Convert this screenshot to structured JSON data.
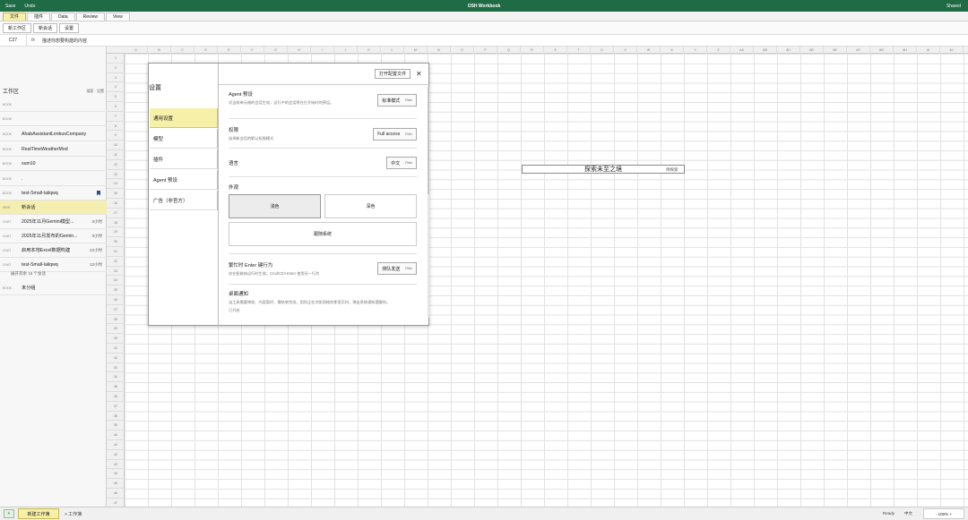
{
  "window": {
    "title": "OSH Workbook",
    "save": "Save",
    "undo": "Undo",
    "shared": "Shared"
  },
  "menu": {
    "tabs": [
      "文件",
      "插件",
      "Data",
      "Review",
      "View"
    ],
    "active_index": 0
  },
  "toolbar": {
    "buttons": [
      "新工作区",
      "新会话",
      "设置"
    ]
  },
  "formula": {
    "cell": "C27",
    "fx": "fx",
    "value": "描述你想要构建的内容"
  },
  "sidebar": {
    "header": "工作区",
    "header_actions": "搜索 · 设置",
    "items": [
      {
        "tag": "BOOK",
        "name": "",
        "time": ""
      },
      {
        "tag": "BOOK",
        "name": "",
        "time": ""
      },
      {
        "tag": "BOOK",
        "name": "AhabAssistantLimbusCompany",
        "time": ""
      },
      {
        "tag": "BOOK",
        "name": "RealTimeWeatherMod",
        "time": ""
      },
      {
        "tag": "BOOK",
        "name": "sum10",
        "time": ""
      },
      {
        "tag": "BOOK",
        "name": ".",
        "time": ""
      },
      {
        "tag": "BOOK",
        "name": "test-Small-laliqwq",
        "time": ""
      },
      {
        "tag": "NEW",
        "name": "新会话",
        "time": ""
      },
      {
        "tag": "CHAT",
        "name": "2025年11月Gemini模型...",
        "time": "3小时"
      },
      {
        "tag": "CHAT",
        "name": "2025年11月发布的Gemin...",
        "time": "3小时"
      },
      {
        "tag": "CHAT",
        "name": "启用本地Excel数据构建",
        "time": "12小时"
      },
      {
        "tag": "CHAT",
        "name": "test-Small-laliqwq",
        "time": "12小时"
      }
    ],
    "more": "展开其余 16 个会话",
    "ungrouped_tag": "BOOK",
    "ungrouped": "未分组"
  },
  "grid": {
    "columns": [
      "A",
      "B",
      "C",
      "D",
      "E",
      "F",
      "G",
      "H",
      "I",
      "J",
      "K",
      "L",
      "M",
      "N",
      "O",
      "P",
      "Q",
      "R",
      "S",
      "T",
      "U",
      "V",
      "W",
      "X",
      "Y",
      "Z",
      "AA",
      "AB",
      "AC",
      "AD",
      "AE",
      "AF",
      "AG",
      "AH",
      "AI",
      "AJ",
      "AK"
    ],
    "rows": 47,
    "cell_text": "探索未至之境",
    "cell_tag": "待探索"
  },
  "settings": {
    "title": "设置",
    "nav": [
      "通用设置",
      "模型",
      "插件",
      "Agent 预设",
      "广告（非官方）"
    ],
    "active_nav": 0,
    "open_file": "打开配置文件",
    "close": "✕",
    "agent": {
      "title": "Agent 预设",
      "desc": "对当前单元格的会话生效，运行中的会话将在它开始时的预设。",
      "value": "标准模式",
      "filter": "Filter"
    },
    "permission": {
      "title": "权限",
      "desc": "选择新会话的默认权限模式",
      "value": "Full access",
      "filter": "Filter"
    },
    "language": {
      "title": "语言",
      "value": "中文",
      "filter": "Filter"
    },
    "appearance": {
      "title": "外观",
      "light": "浅色",
      "dark": "深色",
      "system": "跟随系统"
    },
    "enter": {
      "title": "繁忙时 Enter 键行为",
      "desc": "仅在智能体运行时生效，Cmd/Ctrl+Enter 使用另一行为",
      "value": "排队发送",
      "filter": "Filter"
    },
    "notify": {
      "title": "桌面通知",
      "desc": "当工具需要审批、内容暂时、需结束完成、用你正在浏览网络你那里页时，弹出系统通知提醒你。",
      "status": "已开启"
    }
  },
  "bottom": {
    "icon": "+",
    "sheet": "新建工作簿",
    "add": "+ 工作簿",
    "ready": "Ready",
    "lang": "中文",
    "zoom": "- 100% +"
  }
}
